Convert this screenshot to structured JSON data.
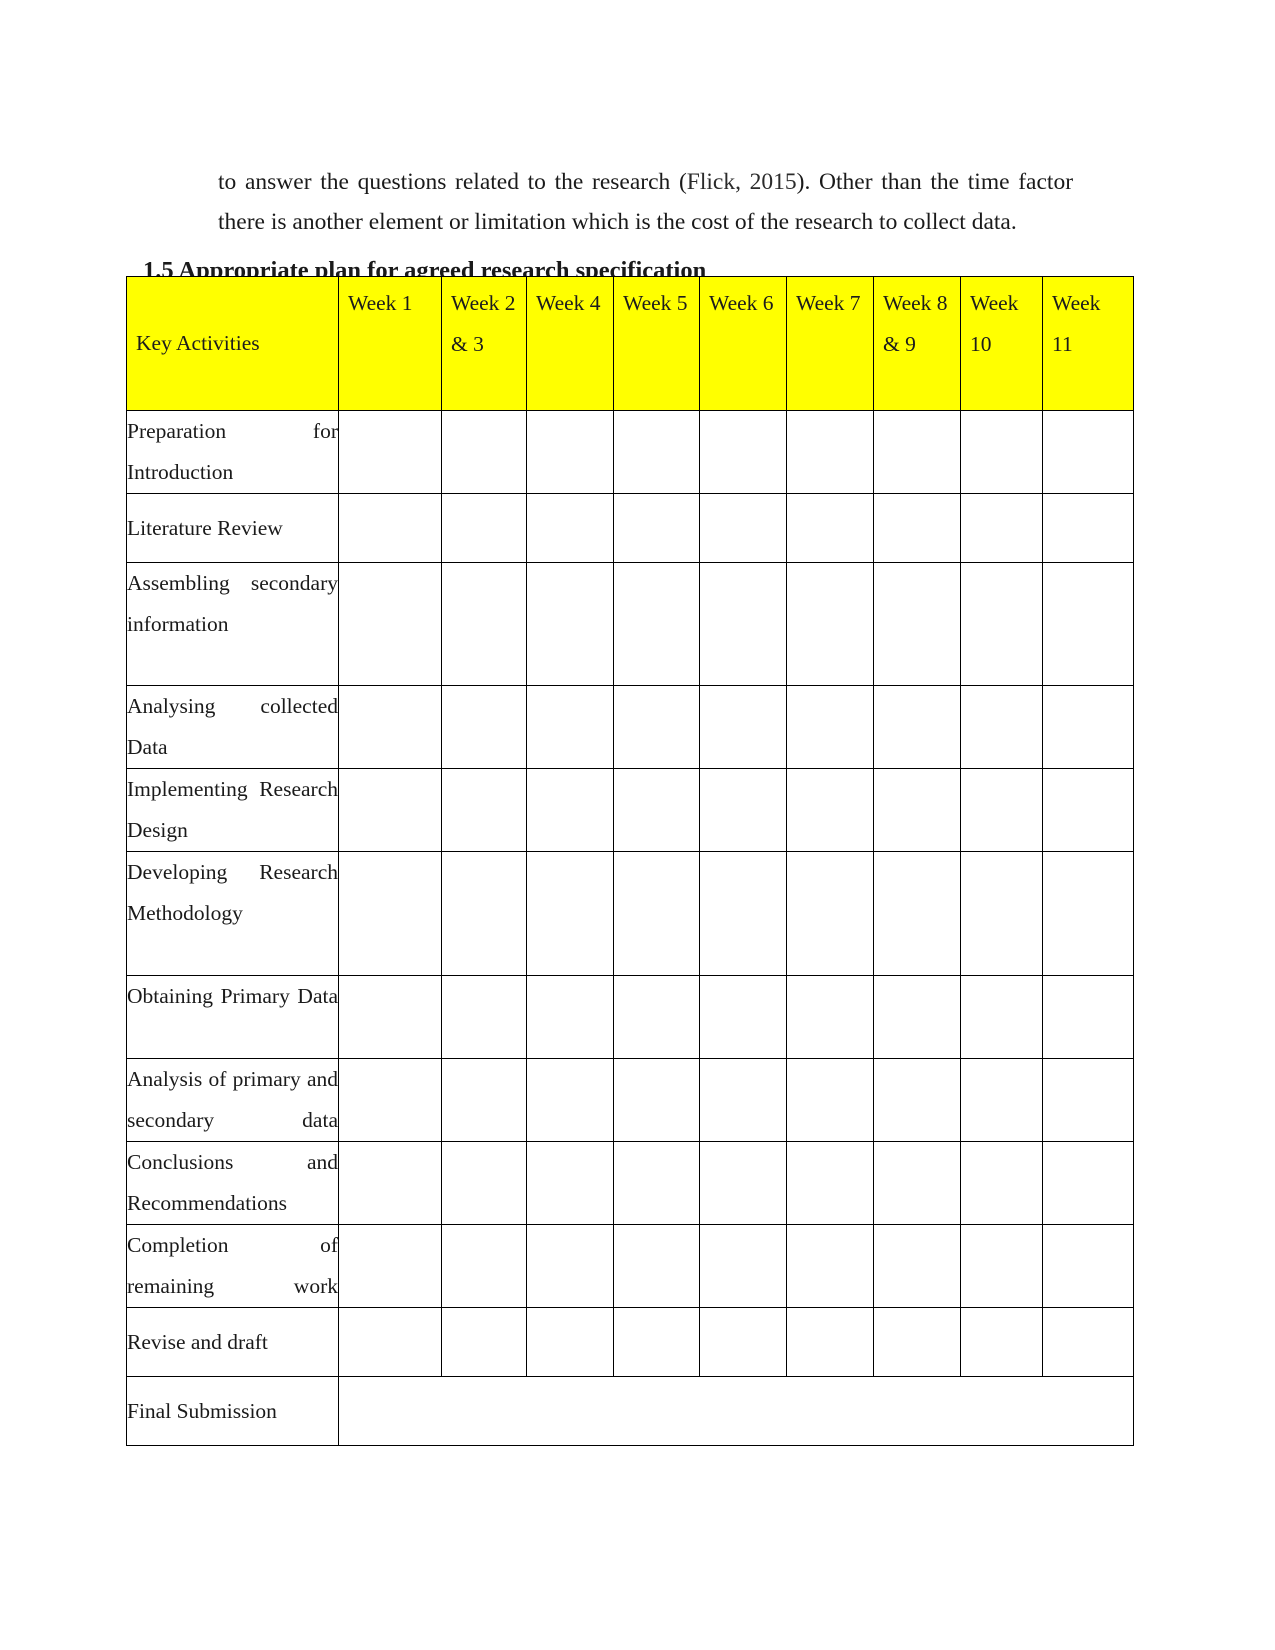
{
  "paragraph": {
    "text_before_cite": "to answer the questions related to the research (",
    "citation": "Flick, 2015",
    "text_after_cite": "). Other than the time factor there is another element or limitation which is the cost of the research to collect data."
  },
  "heading": "1.5 Appropriate plan for agreed research specification",
  "table": {
    "row_header_label": "Key Activities",
    "columns": [
      "Week 1",
      "Week 2  & 3",
      "Week 4",
      "Week 5",
      "Week 6",
      "Week 7",
      "Week 8 & 9",
      "Week 10",
      "Week 11"
    ],
    "rows": [
      {
        "activity": "Preparation for Introduction",
        "fills": [
          "green",
          "",
          "",
          "",
          "",
          "",
          "",
          "",
          ""
        ]
      },
      {
        "activity": "Literature Review",
        "fills": [
          "",
          "red",
          "",
          "",
          "",
          "",
          "",
          "",
          ""
        ]
      },
      {
        "activity": "Assembling secondary information",
        "fills": [
          "",
          "",
          "maroon",
          "",
          "",
          "",
          "",
          "",
          ""
        ]
      },
      {
        "activity": "Analysing collected Data",
        "fills": [
          "",
          "",
          "",
          "pink",
          "",
          "",
          "",
          "",
          ""
        ]
      },
      {
        "activity": "Implementing Research Design",
        "fills": [
          "",
          "",
          "",
          "",
          "purple",
          "",
          "",
          "",
          ""
        ]
      },
      {
        "activity": "Developing Research Methodology",
        "fills": [
          "",
          "",
          "",
          "",
          "purple",
          "",
          "",
          "",
          ""
        ]
      },
      {
        "activity": "Obtaining Primary Data",
        "fills": [
          "",
          "",
          "",
          "",
          "",
          "gray",
          "",
          "",
          ""
        ]
      },
      {
        "activity": "Analysis of primary and secondary data",
        "fills": [
          "",
          "",
          "",
          "",
          "",
          "",
          "khaki",
          "",
          ""
        ]
      },
      {
        "activity": "Conclusions and Recommendations",
        "fills": [
          "",
          "",
          "",
          "",
          "",
          "",
          "",
          "cyan",
          ""
        ]
      },
      {
        "activity": "Completion of remaining work",
        "fills": [
          "",
          "",
          "",
          "",
          "",
          "",
          "",
          "",
          "orange"
        ]
      },
      {
        "activity": "Revise and draft",
        "fills": [
          "",
          "",
          "",
          "",
          "",
          "",
          "",
          "",
          "orange"
        ]
      },
      {
        "activity": "Final Submission",
        "fills": []
      }
    ]
  },
  "colors": {
    "header_background": "#ffff00",
    "activity_background": "#e4e0ea",
    "green": "#008000",
    "red": "#fe0000",
    "maroon": "#5d0227",
    "pink": "#e5b6b2",
    "purple": "#a897c4",
    "gray": "#bebebe",
    "khaki": "#c3ba9b",
    "cyan": "#5ffbfb",
    "orange": "#fbaf01"
  }
}
